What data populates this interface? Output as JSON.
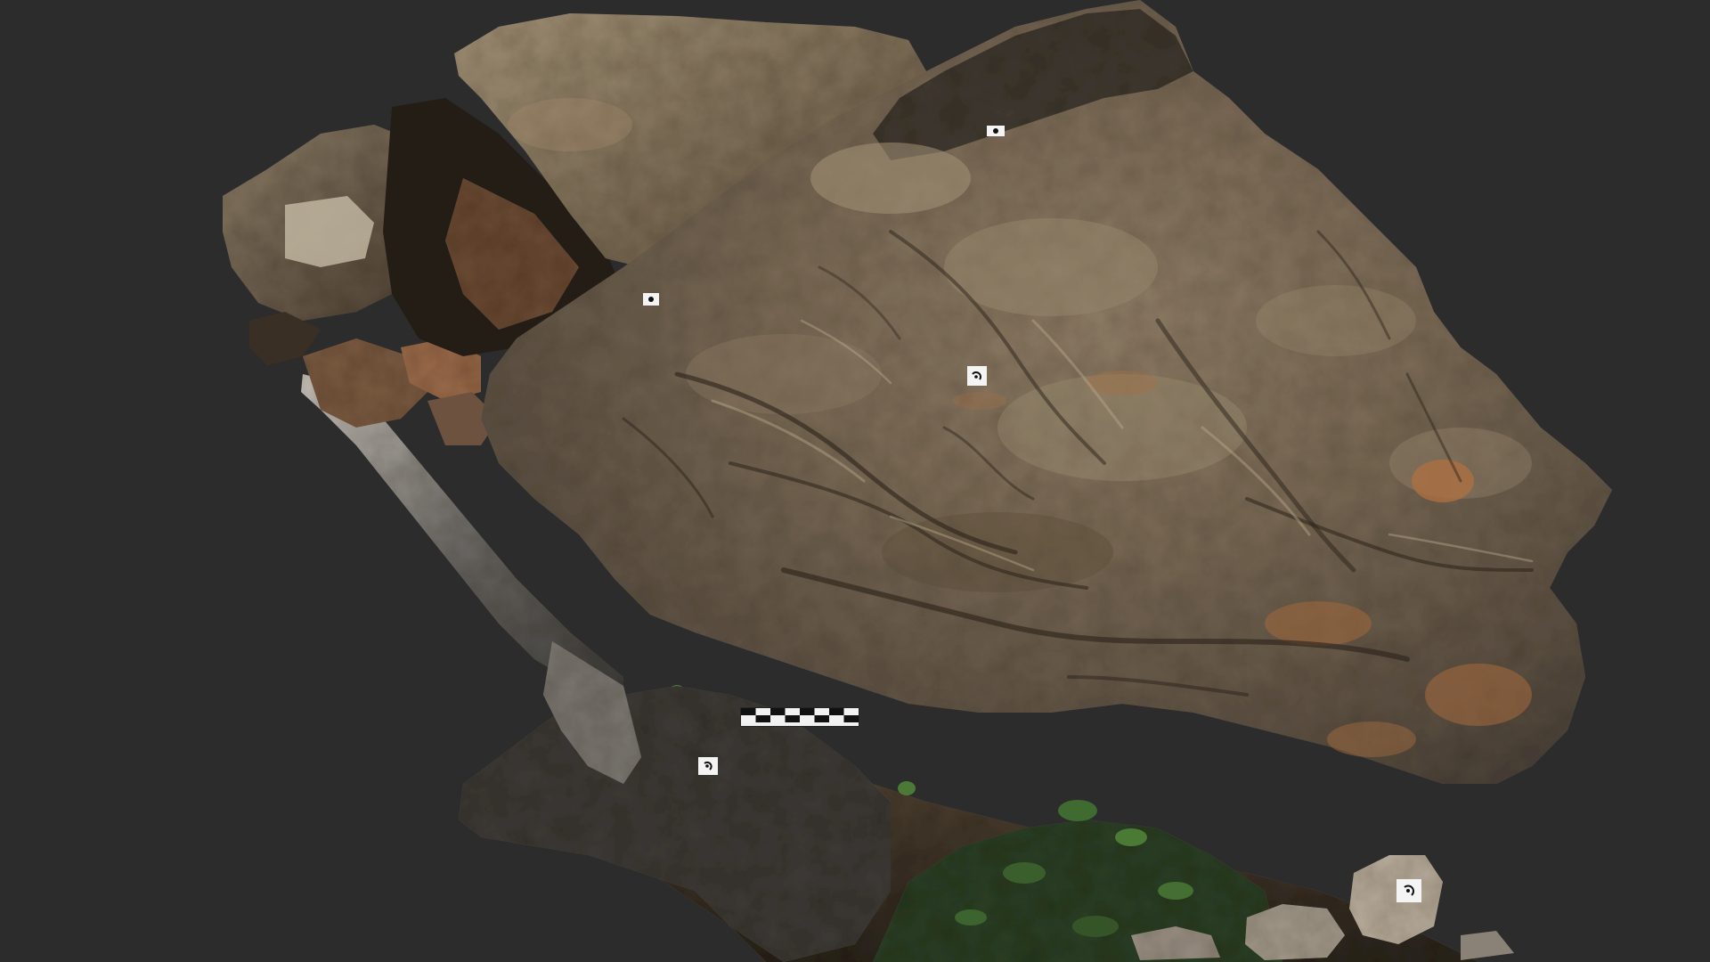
{
  "scene": {
    "background_color": "#2c2c2c",
    "subject": "rock-outcrop-3d-photogrammetry-model",
    "rock_colors": {
      "main": "#6b5a44",
      "dark": "#3f3428",
      "light": "#9a8a70",
      "highlight": "#b8a98c",
      "rust": "#9a6a3a",
      "shadow": "#241d16",
      "vegetation": "#2f4a28",
      "moss": "#5a6b3a"
    },
    "markers": [
      {
        "name": "target-marker-upper",
        "icon": "target-marker-icon"
      },
      {
        "name": "target-marker-left-upper",
        "icon": "target-marker-icon"
      },
      {
        "name": "target-marker-center",
        "icon": "target-marker-icon"
      },
      {
        "name": "target-marker-lower-left",
        "icon": "target-marker-icon"
      },
      {
        "name": "target-marker-lower-right",
        "icon": "target-marker-icon"
      }
    ],
    "scale_bar": {
      "name": "scale-bar",
      "segments": 8,
      "colors": [
        "#111111",
        "#f2f2f2"
      ]
    }
  }
}
